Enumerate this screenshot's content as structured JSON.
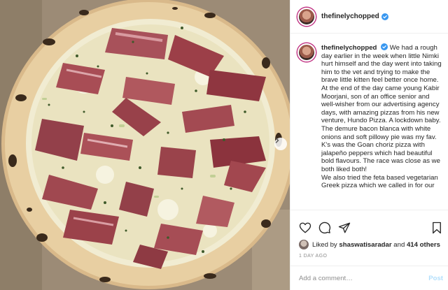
{
  "post": {
    "image_alt_subject": "pizza-photo",
    "username": "thefinelychopped",
    "caption_paragraphs": [
      "We had a rough day earlier in the week when little Nimki hurt himself and the day went into taking him to the vet and trying to make the brave little kitten feel better once home.",
      "At the end of the day came young Kabir Moorjani, son of an office senior and well-wisher from our advertising agency days, with amazing pizzas from his new venture, Hundo Pizza. A lockdown baby.",
      "The demure bacon blanca with white onions and soft pillowy pie was my fav. K's was the Goan choriz pizza with jalapeño peppers which had beautiful bold flavours. The race was close as we both liked both!",
      "We also tried the feta based vegetarian Greek pizza which we called in for our"
    ],
    "liked_by_prefix": "Liked by",
    "liked_by_user": "shaswatisaradar",
    "liked_by_join": "and",
    "others_count": "414 others",
    "timestamp": "1 DAY AGO",
    "comment_placeholder": "Add a comment…",
    "post_button": "Post"
  },
  "colors": {
    "verified_badge": "#3897f0",
    "post_button_disabled": "#b2dffc",
    "muted_text": "#8e8e8e"
  },
  "icons": {
    "like": "heart-icon",
    "comment": "comment-icon",
    "share": "share-icon",
    "save": "bookmark-icon",
    "carousel_next": "chevron-right-icon"
  }
}
